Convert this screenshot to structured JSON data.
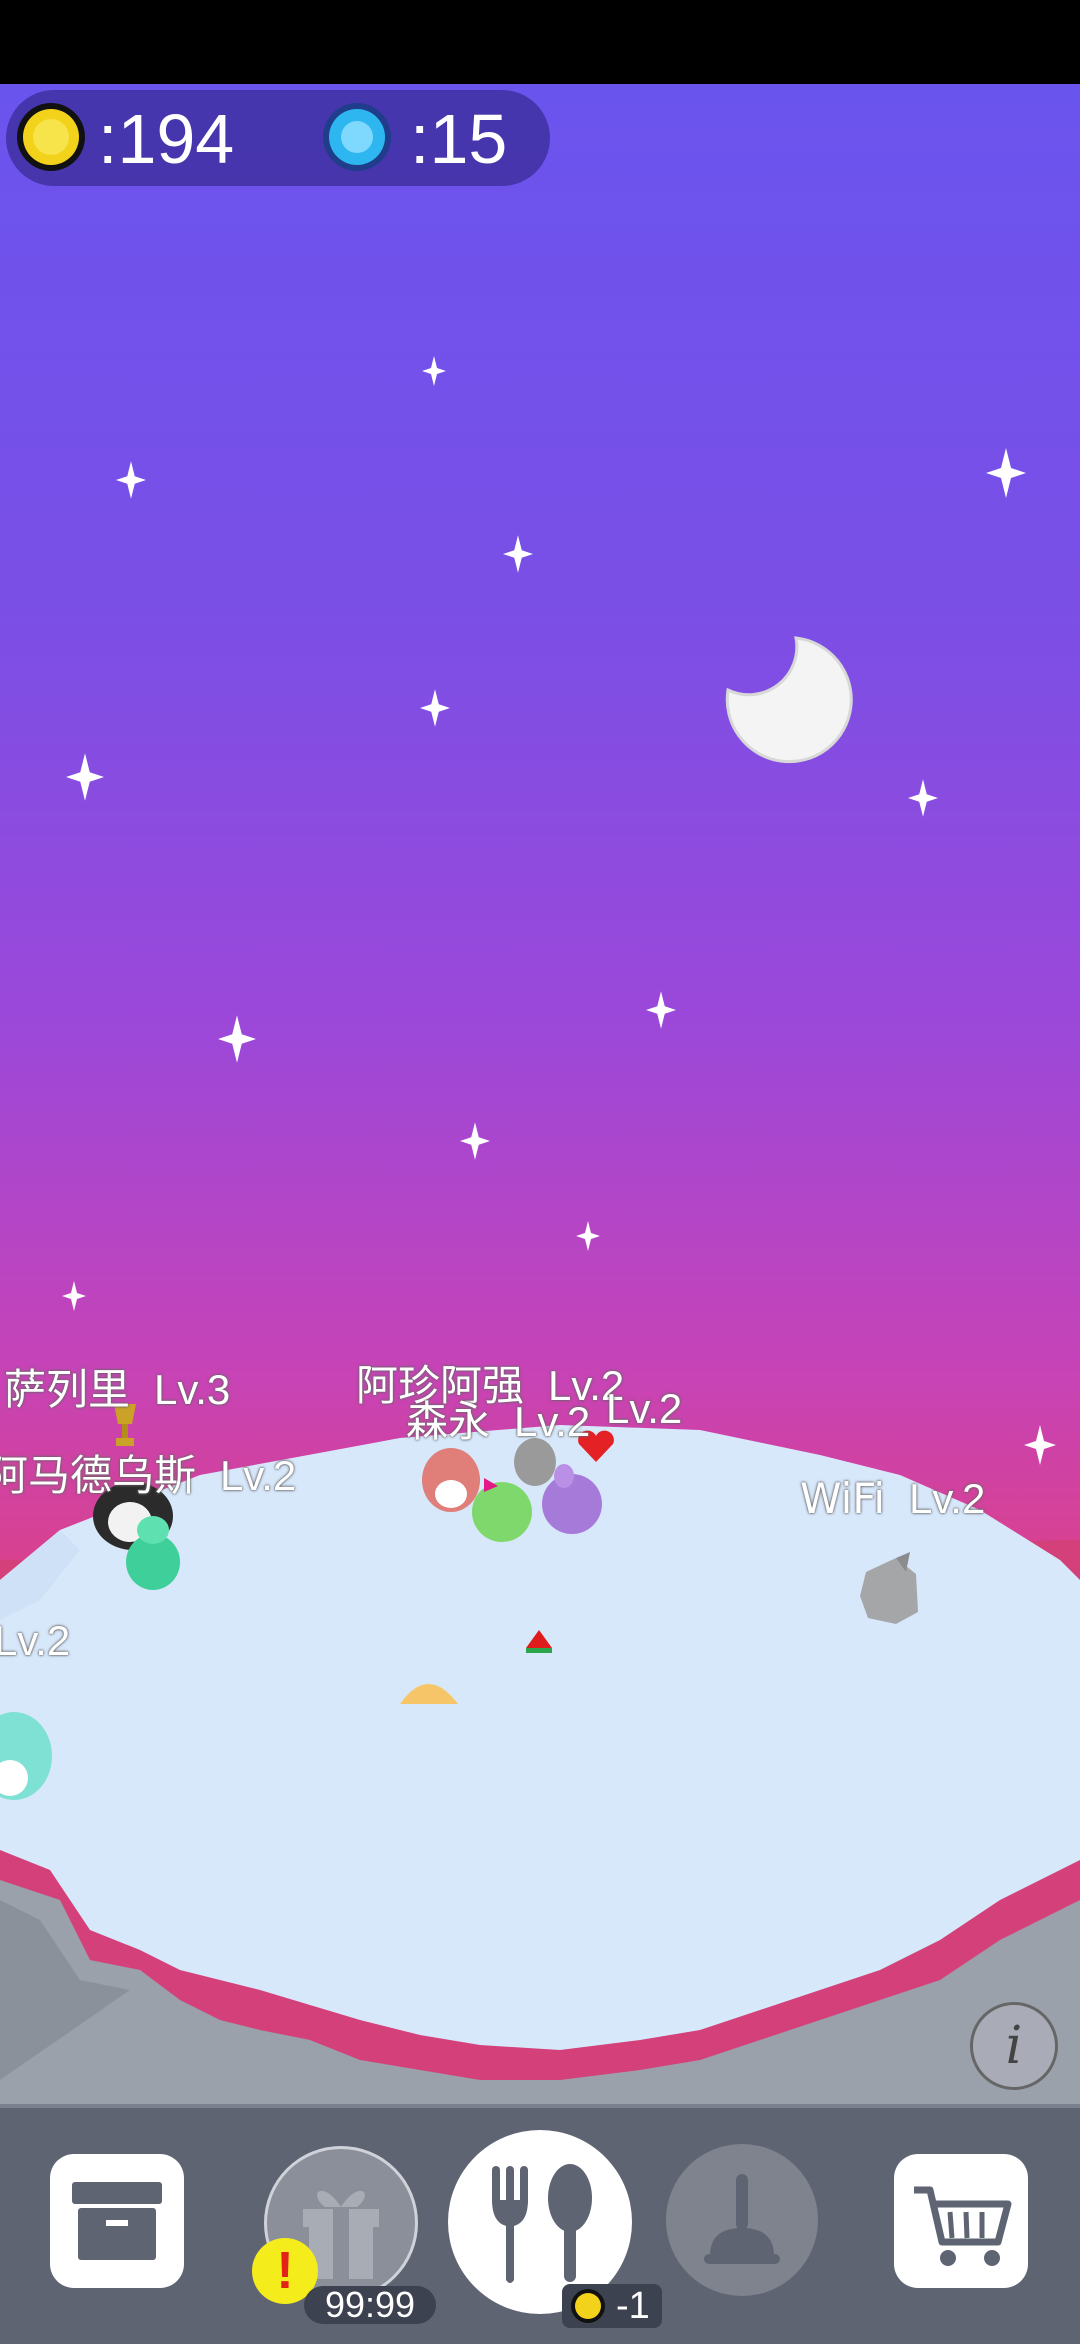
{
  "hud": {
    "coins": ":194",
    "gems": ":15"
  },
  "pets": [
    {
      "name": "萨列里",
      "level": "Lv.3"
    },
    {
      "name": "阿马德乌斯",
      "level": "Lv.2"
    },
    {
      "name": "",
      "level": "Lv.2"
    },
    {
      "name": "阿珍阿强",
      "level": "Lv.2"
    },
    {
      "name": "森永",
      "level": "Lv.2"
    },
    {
      "name": "",
      "level": "Lv.2"
    },
    {
      "name": "WiFi",
      "level": "Lv.2"
    }
  ],
  "toolbar": {
    "storage_icon": "storage-box-icon",
    "gift_icon": "gift-icon",
    "gift_timer": "99:99",
    "gift_alert": "!",
    "feed_icon": "fork-spoon-icon",
    "feed_cost": "-1",
    "clean_icon": "plunger-icon",
    "shop_icon": "cart-icon",
    "info_label": "i"
  },
  "colors": {
    "toolbar_bg": "#5e6472",
    "coin": "#f2d21b",
    "gem": "#2db6f0"
  }
}
